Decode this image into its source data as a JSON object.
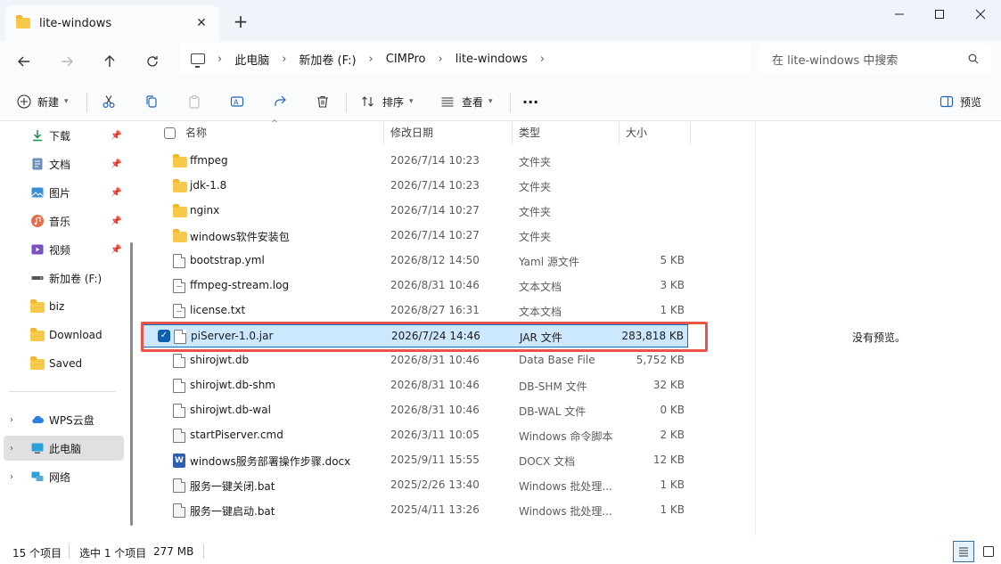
{
  "window": {
    "tab_title": "lite-windows",
    "tab_close": "✕",
    "new_tab": "+",
    "minimize": "—",
    "maximize": "☐",
    "close": "✕"
  },
  "address": {
    "crumbs": [
      "此电脑",
      "新加卷 (F:)",
      "CIMPro",
      "lite-windows"
    ],
    "sep": "›",
    "search_placeholder": "在 lite-windows 中搜索"
  },
  "toolbar": {
    "new_label": "新建",
    "sort_label": "排序",
    "view_label": "查看",
    "more_label": "···",
    "preview_label": "预览"
  },
  "sidebar": {
    "quick": [
      {
        "label": "下载",
        "icon": "download-icon"
      },
      {
        "label": "文档",
        "icon": "documents-icon"
      },
      {
        "label": "图片",
        "icon": "pictures-icon"
      },
      {
        "label": "音乐",
        "icon": "music-icon"
      },
      {
        "label": "视频",
        "icon": "videos-icon"
      }
    ],
    "others": [
      {
        "label": "新加卷 (F:)",
        "icon": "drive-icon"
      },
      {
        "label": "biz",
        "icon": "folder-icon"
      },
      {
        "label": "Download",
        "icon": "folder-icon"
      },
      {
        "label": "Saved",
        "icon": "folder-icon"
      }
    ],
    "roots": [
      {
        "label": "WPS云盘",
        "icon": "cloud-icon"
      },
      {
        "label": "此电脑",
        "icon": "computer-icon"
      },
      {
        "label": "网络",
        "icon": "network-icon"
      }
    ]
  },
  "columns": {
    "name": "名称",
    "date": "修改日期",
    "type": "类型",
    "size": "大小"
  },
  "files": [
    {
      "name": "ffmpeg",
      "date": "2026/7/14 10:23",
      "type": "文件夹",
      "size": "",
      "kind": "folder"
    },
    {
      "name": "jdk-1.8",
      "date": "2026/7/14 10:23",
      "type": "文件夹",
      "size": "",
      "kind": "folder"
    },
    {
      "name": "nginx",
      "date": "2026/7/14 10:27",
      "type": "文件夹",
      "size": "",
      "kind": "folder"
    },
    {
      "name": "windows软件安装包",
      "date": "2026/7/14 10:27",
      "type": "文件夹",
      "size": "",
      "kind": "folder"
    },
    {
      "name": "bootstrap.yml",
      "date": "2026/8/12 14:50",
      "type": "Yaml 源文件",
      "size": "5 KB",
      "kind": "doc"
    },
    {
      "name": "ffmpeg-stream.log",
      "date": "2026/8/31 10:46",
      "type": "文本文档",
      "size": "3 KB",
      "kind": "lines"
    },
    {
      "name": "license.txt",
      "date": "2026/8/27 16:31",
      "type": "文本文档",
      "size": "1 KB",
      "kind": "lines"
    },
    {
      "name": "piServer-1.0.jar",
      "date": "2026/7/24 14:46",
      "type": "JAR 文件",
      "size": "283,818 KB",
      "kind": "doc",
      "selected": true
    },
    {
      "name": "shirojwt.db",
      "date": "2026/8/31 10:46",
      "type": "Data Base File",
      "size": "5,752 KB",
      "kind": "doc"
    },
    {
      "name": "shirojwt.db-shm",
      "date": "2026/8/31 10:46",
      "type": "DB-SHM 文件",
      "size": "32 KB",
      "kind": "doc"
    },
    {
      "name": "shirojwt.db-wal",
      "date": "2026/8/31 10:46",
      "type": "DB-WAL 文件",
      "size": "0 KB",
      "kind": "doc"
    },
    {
      "name": "startPiserver.cmd",
      "date": "2026/3/11 10:05",
      "type": "Windows 命令脚本",
      "size": "2 KB",
      "kind": "cmd"
    },
    {
      "name": "windows服务部署操作步骤.docx",
      "date": "2025/9/11 15:55",
      "type": "DOCX 文档",
      "size": "12 KB",
      "kind": "word"
    },
    {
      "name": "服务一键关闭.bat",
      "date": "2025/2/26 13:40",
      "type": "Windows 批处理...",
      "size": "1 KB",
      "kind": "cmd"
    },
    {
      "name": "服务一键启动.bat",
      "date": "2025/4/11 13:26",
      "type": "Windows 批处理...",
      "size": "1 KB",
      "kind": "cmd"
    }
  ],
  "preview": {
    "empty_text": "没有预览。"
  },
  "status": {
    "count": "15 个项目",
    "selection": "选中 1 个项目",
    "size": "277 MB"
  },
  "colors": {
    "accent": "#0c71c3",
    "selection_bg": "#cce8ff",
    "highlight": "#e8534a",
    "folder": "#f7c948"
  }
}
